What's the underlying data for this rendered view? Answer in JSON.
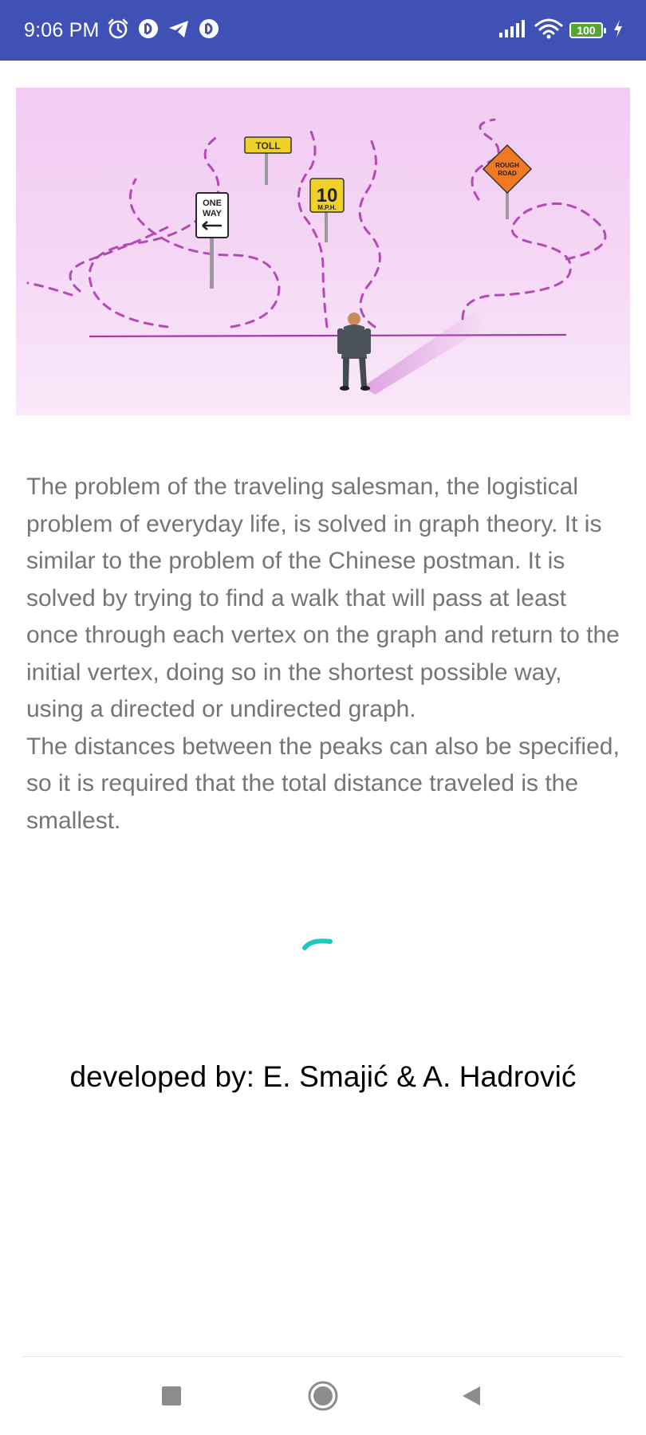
{
  "status_bar": {
    "time": "9:06 PM",
    "battery": "100",
    "background_color": "#3f51b5",
    "left_icons": [
      "alarm-icon",
      "pocket-casts-icon",
      "telegram-icon",
      "pocket-casts-icon"
    ],
    "right_icons": [
      "signal-icon",
      "wifi-icon",
      "battery-icon",
      "charging-icon"
    ]
  },
  "hero_image": {
    "signs": {
      "one_way_line1": "ONE",
      "one_way_line2": "WAY",
      "toll": "TOLL",
      "speed_number": "10",
      "speed_unit": "M.P.H.",
      "rough_line1": "ROUGH",
      "rough_line2": "ROAD"
    }
  },
  "content": {
    "paragraph1": "The problem of the traveling salesman, the logistical problem of everyday life, is solved in graph theory. It is similar to the problem of the Chinese postman. It is solved by trying to find a walk that will pass at least once through each vertex on the graph and return to the initial vertex, doing so in the shortest possible way, using a directed or undirected graph.",
    "paragraph2": "The distances between the peaks can also be specified, so it is required that the total distance traveled is the smallest.",
    "text_color": "#757575"
  },
  "loading_spinner": {
    "color": "#1ec8bf"
  },
  "credits": {
    "text": "developed by: E. Smajić & A. Hadrović"
  },
  "navigation_bar": {
    "buttons": [
      "recents-button",
      "home-button",
      "back-button"
    ]
  }
}
